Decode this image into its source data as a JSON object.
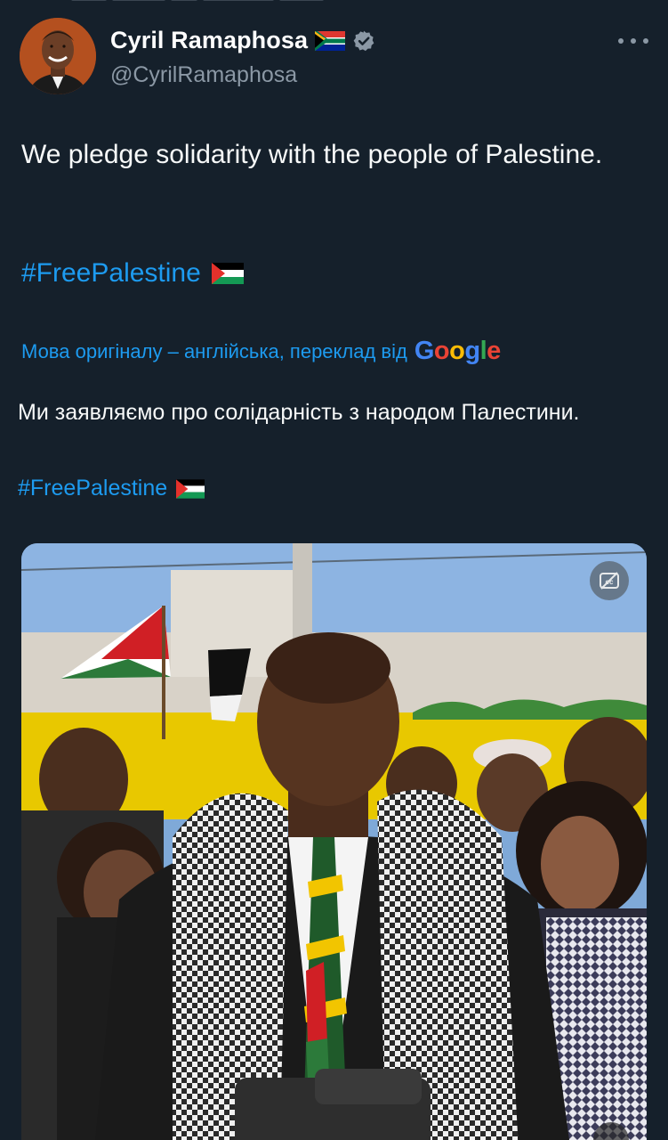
{
  "tweet": {
    "author": {
      "display_name": "Cyril Ramaphosa",
      "handle": "@CyrilRamaphosa",
      "verified": true,
      "flag_emoji": "south-africa-flag"
    },
    "text": "We pledge solidarity with the people of Palestine.",
    "hashtag": "#FreePalestine",
    "hashtag_flag": "palestine-flag",
    "translation": {
      "notice": "Мова оригіналу – англійська, переклад від",
      "provider": "Google",
      "text": "Ми заявляємо про солідарність з народом Палестини.",
      "hashtag": "#FreePalestine"
    },
    "media": {
      "type": "video",
      "controls": [
        "captions-off-icon",
        "mute-icon"
      ]
    }
  },
  "colors": {
    "background": "#15202b",
    "link": "#1d9bf0",
    "secondary_text": "#8b98a5",
    "primary_text": "#f7f9f9"
  }
}
